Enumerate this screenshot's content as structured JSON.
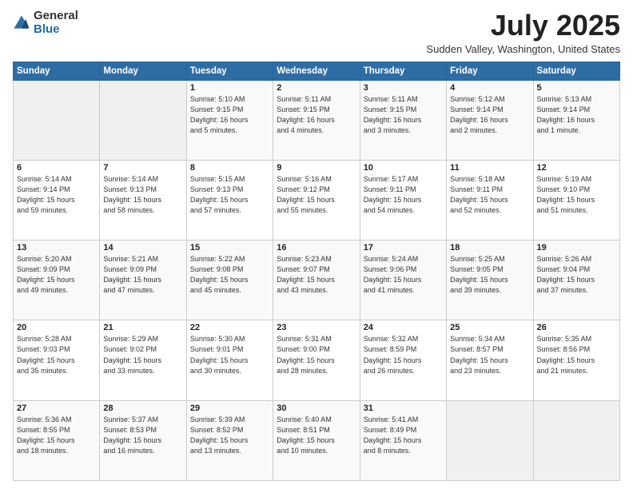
{
  "logo": {
    "general": "General",
    "blue": "Blue"
  },
  "title": "July 2025",
  "subtitle": "Sudden Valley, Washington, United States",
  "days_of_week": [
    "Sunday",
    "Monday",
    "Tuesday",
    "Wednesday",
    "Thursday",
    "Friday",
    "Saturday"
  ],
  "weeks": [
    [
      {
        "num": "",
        "info": ""
      },
      {
        "num": "",
        "info": ""
      },
      {
        "num": "1",
        "info": "Sunrise: 5:10 AM\nSunset: 9:15 PM\nDaylight: 16 hours\nand 5 minutes."
      },
      {
        "num": "2",
        "info": "Sunrise: 5:11 AM\nSunset: 9:15 PM\nDaylight: 16 hours\nand 4 minutes."
      },
      {
        "num": "3",
        "info": "Sunrise: 5:11 AM\nSunset: 9:15 PM\nDaylight: 16 hours\nand 3 minutes."
      },
      {
        "num": "4",
        "info": "Sunrise: 5:12 AM\nSunset: 9:14 PM\nDaylight: 16 hours\nand 2 minutes."
      },
      {
        "num": "5",
        "info": "Sunrise: 5:13 AM\nSunset: 9:14 PM\nDaylight: 16 hours\nand 1 minute."
      }
    ],
    [
      {
        "num": "6",
        "info": "Sunrise: 5:14 AM\nSunset: 9:14 PM\nDaylight: 15 hours\nand 59 minutes."
      },
      {
        "num": "7",
        "info": "Sunrise: 5:14 AM\nSunset: 9:13 PM\nDaylight: 15 hours\nand 58 minutes."
      },
      {
        "num": "8",
        "info": "Sunrise: 5:15 AM\nSunset: 9:13 PM\nDaylight: 15 hours\nand 57 minutes."
      },
      {
        "num": "9",
        "info": "Sunrise: 5:16 AM\nSunset: 9:12 PM\nDaylight: 15 hours\nand 55 minutes."
      },
      {
        "num": "10",
        "info": "Sunrise: 5:17 AM\nSunset: 9:11 PM\nDaylight: 15 hours\nand 54 minutes."
      },
      {
        "num": "11",
        "info": "Sunrise: 5:18 AM\nSunset: 9:11 PM\nDaylight: 15 hours\nand 52 minutes."
      },
      {
        "num": "12",
        "info": "Sunrise: 5:19 AM\nSunset: 9:10 PM\nDaylight: 15 hours\nand 51 minutes."
      }
    ],
    [
      {
        "num": "13",
        "info": "Sunrise: 5:20 AM\nSunset: 9:09 PM\nDaylight: 15 hours\nand 49 minutes."
      },
      {
        "num": "14",
        "info": "Sunrise: 5:21 AM\nSunset: 9:09 PM\nDaylight: 15 hours\nand 47 minutes."
      },
      {
        "num": "15",
        "info": "Sunrise: 5:22 AM\nSunset: 9:08 PM\nDaylight: 15 hours\nand 45 minutes."
      },
      {
        "num": "16",
        "info": "Sunrise: 5:23 AM\nSunset: 9:07 PM\nDaylight: 15 hours\nand 43 minutes."
      },
      {
        "num": "17",
        "info": "Sunrise: 5:24 AM\nSunset: 9:06 PM\nDaylight: 15 hours\nand 41 minutes."
      },
      {
        "num": "18",
        "info": "Sunrise: 5:25 AM\nSunset: 9:05 PM\nDaylight: 15 hours\nand 39 minutes."
      },
      {
        "num": "19",
        "info": "Sunrise: 5:26 AM\nSunset: 9:04 PM\nDaylight: 15 hours\nand 37 minutes."
      }
    ],
    [
      {
        "num": "20",
        "info": "Sunrise: 5:28 AM\nSunset: 9:03 PM\nDaylight: 15 hours\nand 35 minutes."
      },
      {
        "num": "21",
        "info": "Sunrise: 5:29 AM\nSunset: 9:02 PM\nDaylight: 15 hours\nand 33 minutes."
      },
      {
        "num": "22",
        "info": "Sunrise: 5:30 AM\nSunset: 9:01 PM\nDaylight: 15 hours\nand 30 minutes."
      },
      {
        "num": "23",
        "info": "Sunrise: 5:31 AM\nSunset: 9:00 PM\nDaylight: 15 hours\nand 28 minutes."
      },
      {
        "num": "24",
        "info": "Sunrise: 5:32 AM\nSunset: 8:59 PM\nDaylight: 15 hours\nand 26 minutes."
      },
      {
        "num": "25",
        "info": "Sunrise: 5:34 AM\nSunset: 8:57 PM\nDaylight: 15 hours\nand 23 minutes."
      },
      {
        "num": "26",
        "info": "Sunrise: 5:35 AM\nSunset: 8:56 PM\nDaylight: 15 hours\nand 21 minutes."
      }
    ],
    [
      {
        "num": "27",
        "info": "Sunrise: 5:36 AM\nSunset: 8:55 PM\nDaylight: 15 hours\nand 18 minutes."
      },
      {
        "num": "28",
        "info": "Sunrise: 5:37 AM\nSunset: 8:53 PM\nDaylight: 15 hours\nand 16 minutes."
      },
      {
        "num": "29",
        "info": "Sunrise: 5:39 AM\nSunset: 8:52 PM\nDaylight: 15 hours\nand 13 minutes."
      },
      {
        "num": "30",
        "info": "Sunrise: 5:40 AM\nSunset: 8:51 PM\nDaylight: 15 hours\nand 10 minutes."
      },
      {
        "num": "31",
        "info": "Sunrise: 5:41 AM\nSunset: 8:49 PM\nDaylight: 15 hours\nand 8 minutes."
      },
      {
        "num": "",
        "info": ""
      },
      {
        "num": "",
        "info": ""
      }
    ]
  ]
}
